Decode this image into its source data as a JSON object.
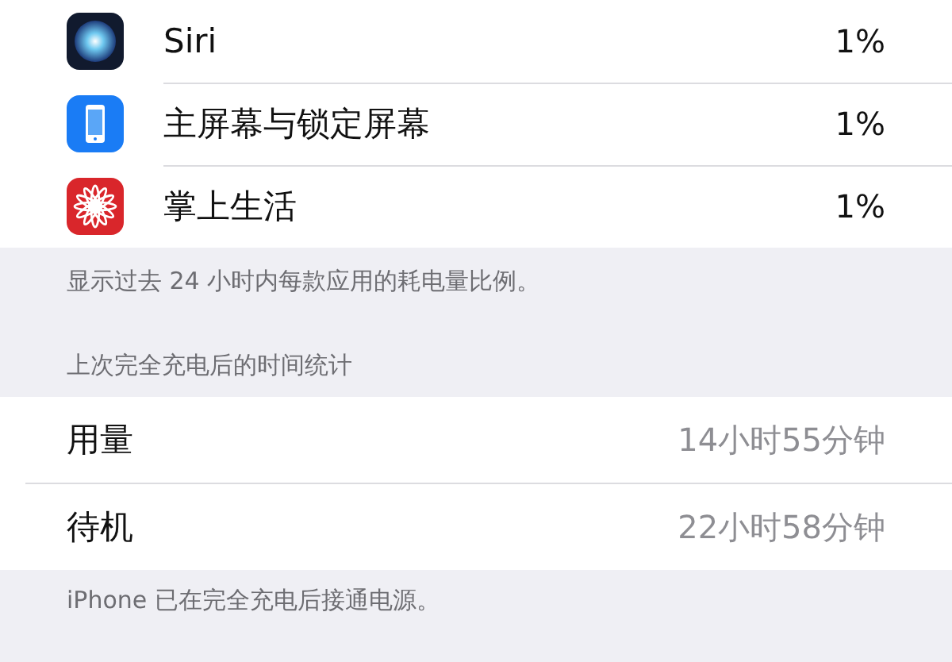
{
  "apps": [
    {
      "name": "Siri",
      "usage": "1%",
      "kind": "siri"
    },
    {
      "name": "主屏幕与锁定屏幕",
      "usage": "1%",
      "kind": "home"
    },
    {
      "name": "掌上生活",
      "usage": "1%",
      "kind": "flower"
    }
  ],
  "apps_note": "显示过去 24 小时内每款应用的耗电量比例。",
  "time_section": {
    "header": "上次完全充电后的时间统计",
    "rows": [
      {
        "label": "用量",
        "value": "14小时55分钟"
      },
      {
        "label": "待机",
        "value": "22小时58分钟"
      }
    ]
  },
  "footer_note": "iPhone 已在完全充电后接通电源。"
}
